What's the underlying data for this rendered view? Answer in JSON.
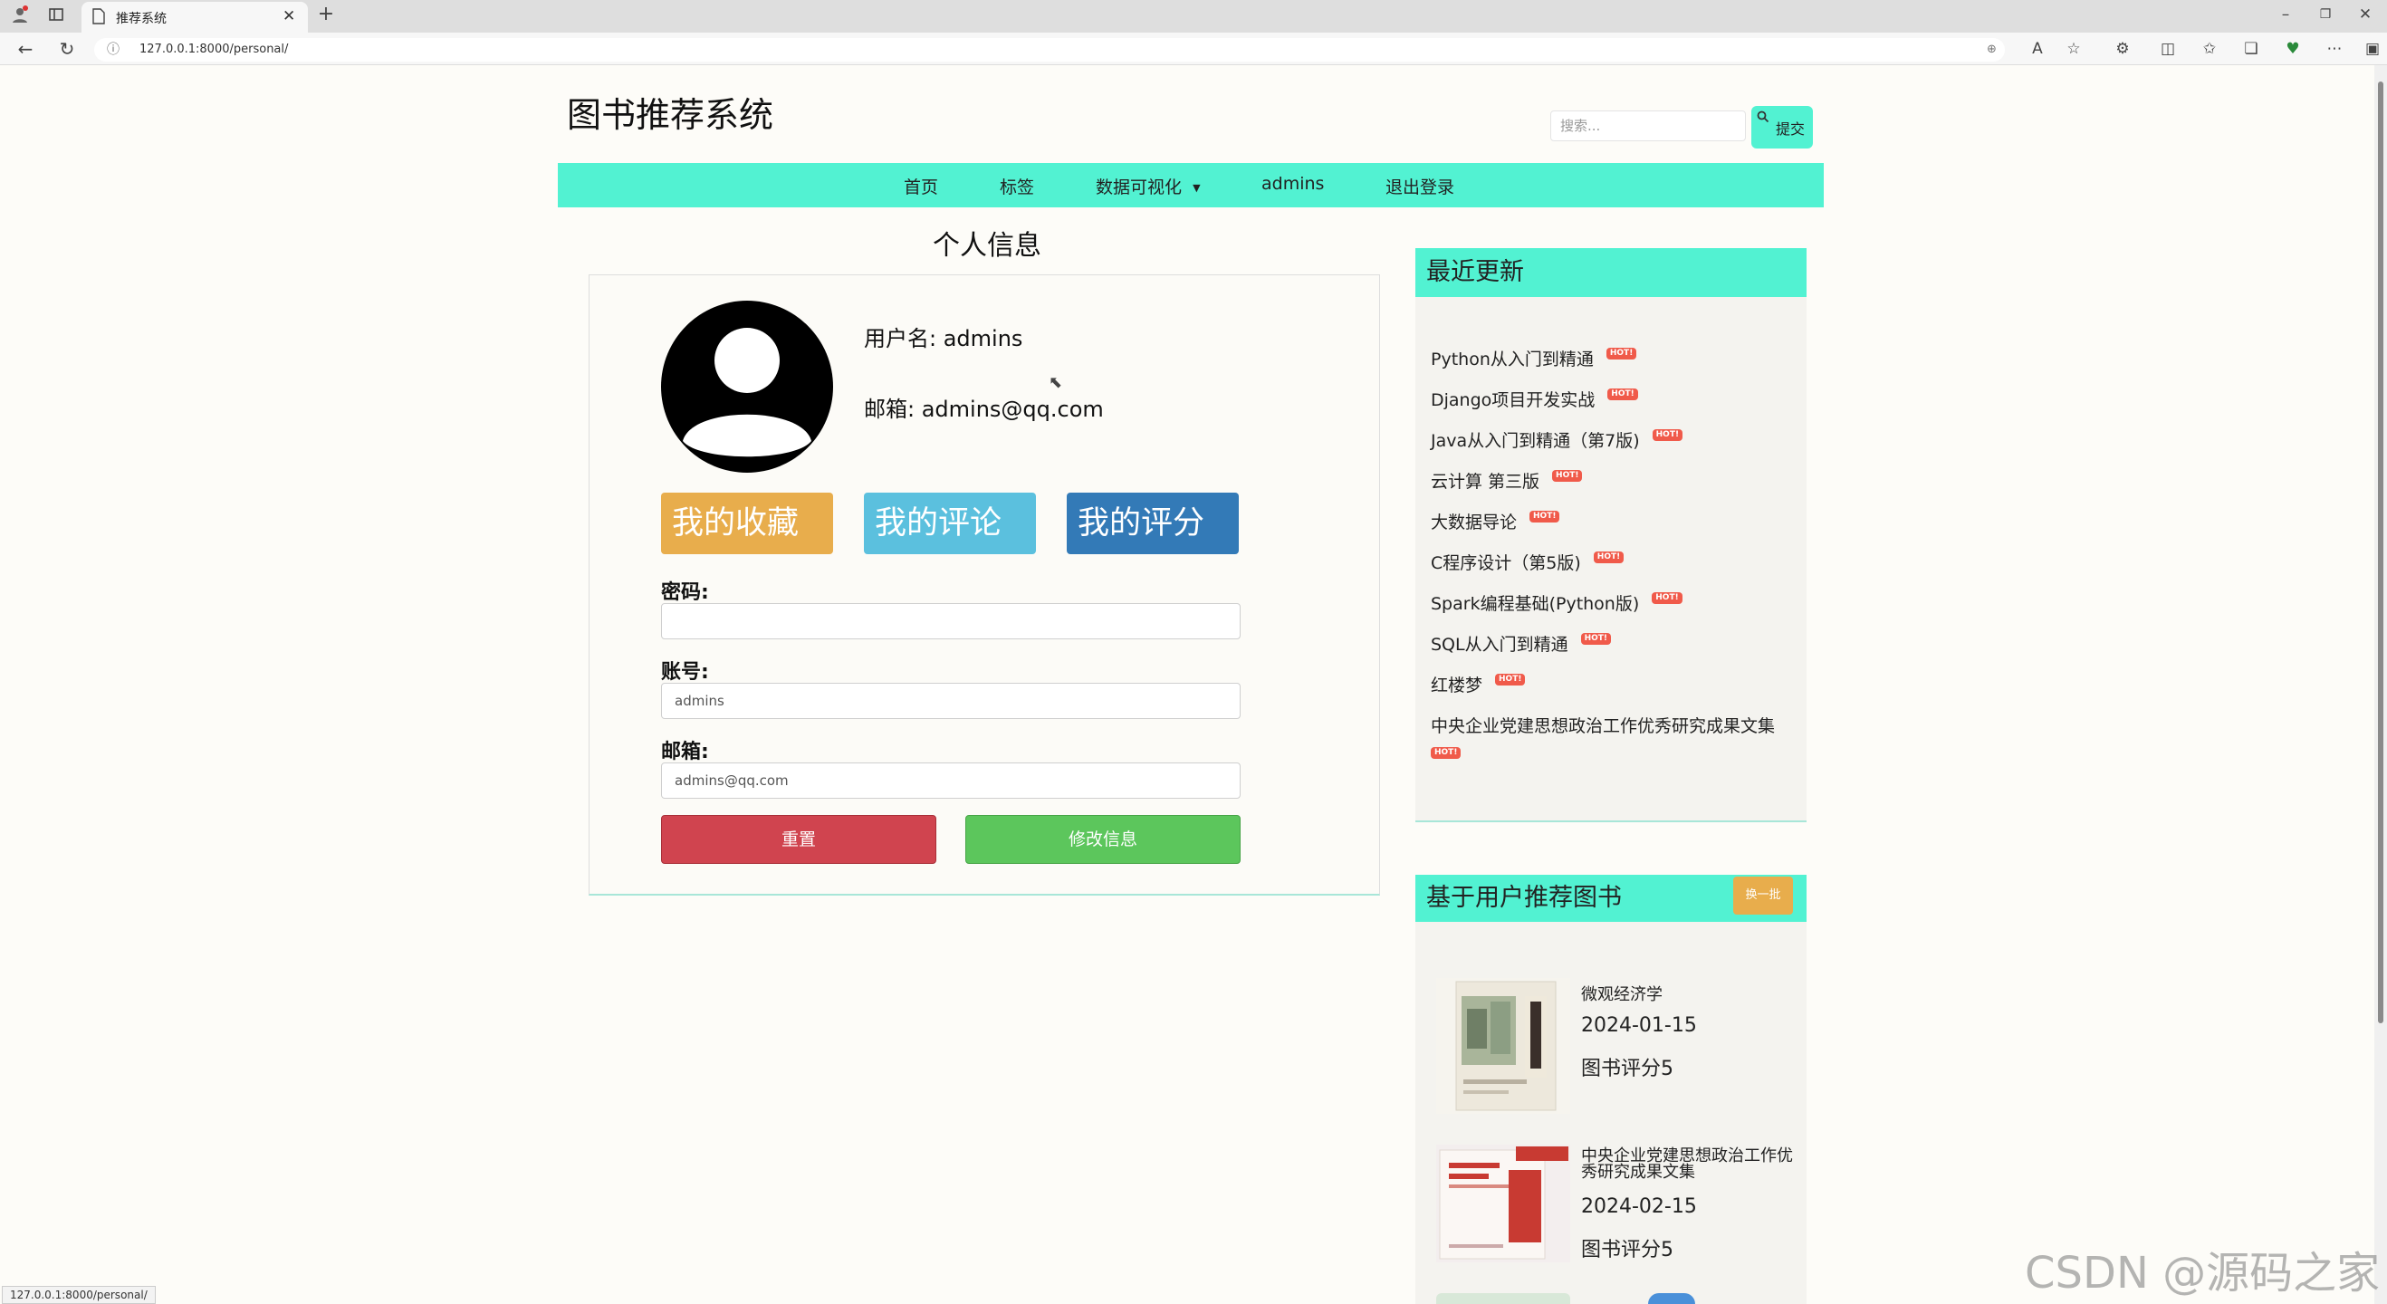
{
  "browser": {
    "tab_title": "推荐系统",
    "url": "127.0.0.1:8000/personal/",
    "status_url": "127.0.0.1:8000/personal/"
  },
  "header": {
    "site_title": "图书推荐系统",
    "search_placeholder": "搜索...",
    "search_button": "提交"
  },
  "nav": {
    "items": [
      "首页",
      "标签",
      "数据可视化",
      "admins",
      "退出登录"
    ]
  },
  "profile": {
    "heading": "个人信息",
    "username_line": "用户名: admins",
    "email_line": "邮箱: admins@qq.com",
    "buttons": {
      "favorites": "我的收藏",
      "comments": "我的评论",
      "ratings": "我的评分"
    },
    "form": {
      "password_label": "密码:",
      "password_value": "",
      "account_label": "账号:",
      "account_value": "admins",
      "email_label": "邮箱:",
      "email_value": "admins@qq.com",
      "reset_button": "重置",
      "submit_button": "修改信息"
    }
  },
  "recent_updates": {
    "heading": "最近更新",
    "hot_badge": "HOT!",
    "items": [
      "Python从入门到精通",
      "Django项目开发实战",
      "Java从入门到精通（第7版)",
      "云计算 第三版",
      "大数据导论",
      "C程序设计（第5版)",
      "Spark编程基础(Python版)",
      "SQL从入门到精通",
      "红楼梦",
      "中央企业党建思想政治工作优秀研究成果文集"
    ]
  },
  "recommend": {
    "heading": "基于用户推荐图书",
    "refresh_button": "换一批",
    "books": [
      {
        "title": "微观经济学",
        "date": "2024-01-15",
        "score": "图书评分5"
      },
      {
        "title": "中央企业党建思想政治工作优秀研究成果文集",
        "date": "2024-02-15",
        "score": "图书评分5"
      }
    ]
  },
  "watermark": "CSDN @源码之家",
  "colors": {
    "nav_bg": "#52f2d2",
    "favorites_btn": "#e8ad4c",
    "comments_btn": "#5bc0de",
    "ratings_btn": "#337ab7",
    "reset_btn": "#d0444f",
    "submit_btn": "#5cc65c"
  }
}
